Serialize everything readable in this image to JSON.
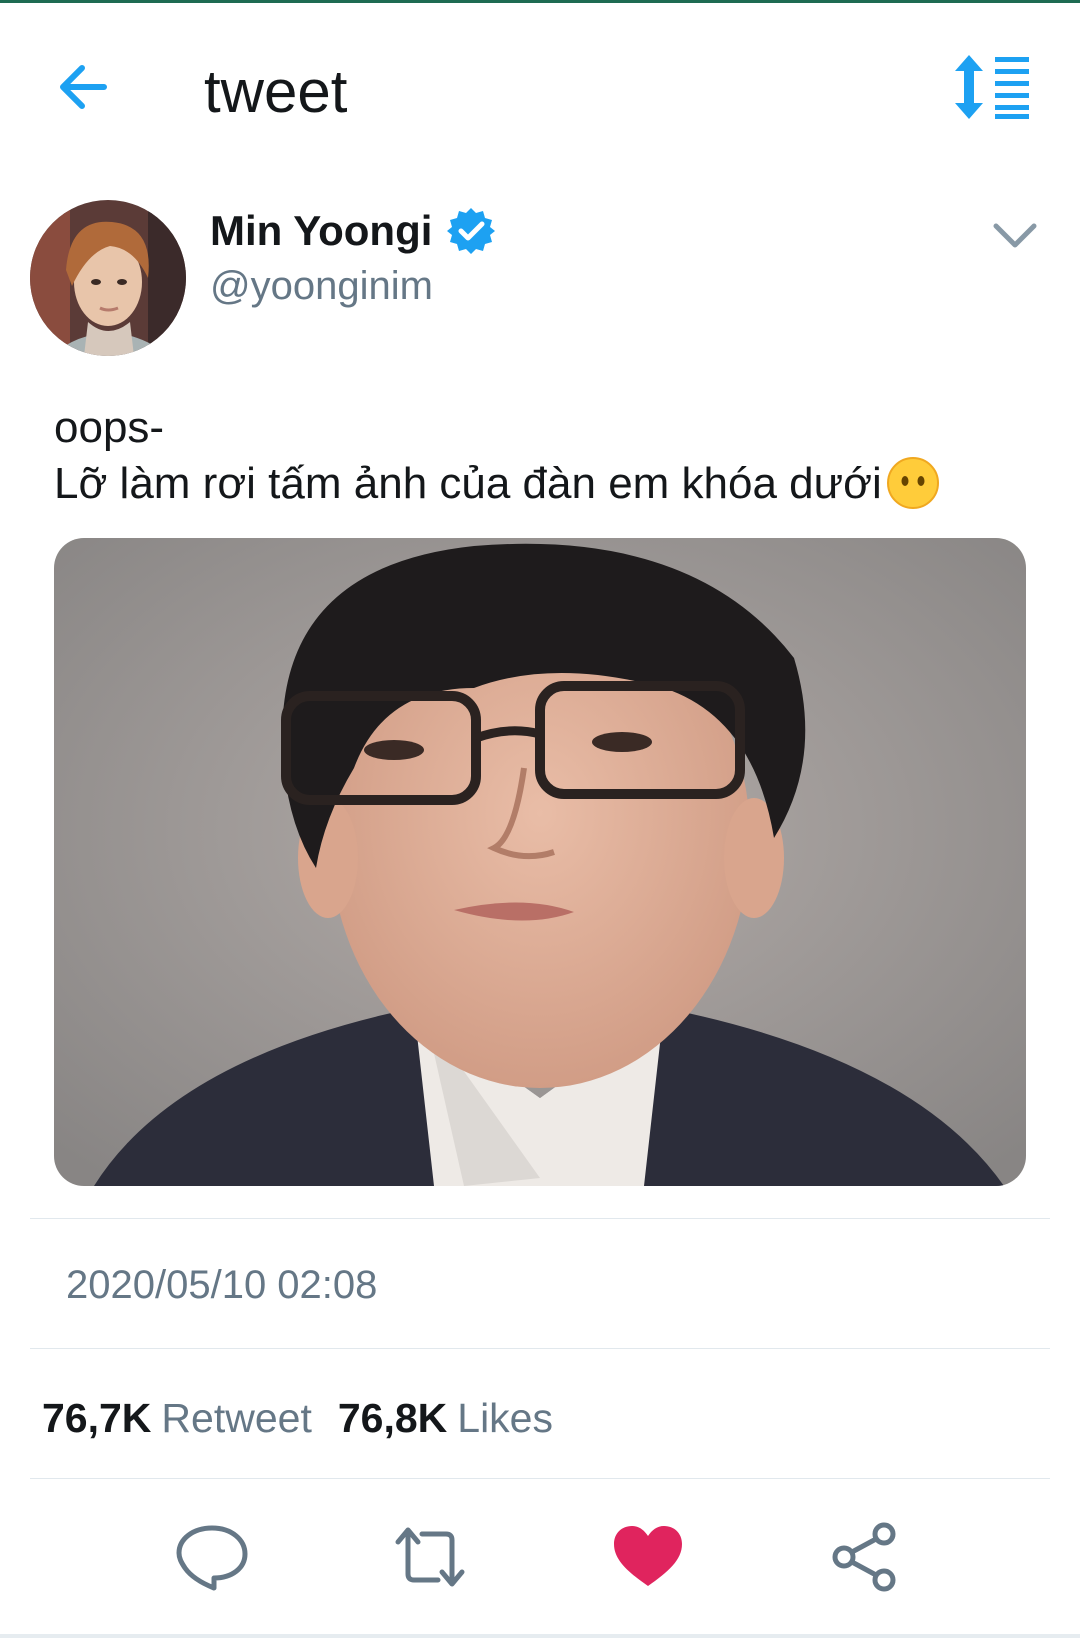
{
  "header": {
    "title": "tweet",
    "back_icon": "arrow-left-icon",
    "sort_icon": "sort-list-icon",
    "accent_color": "#1da1f2"
  },
  "tweet": {
    "author_name": "Min Yoongi",
    "author_handle": "@yoonginim",
    "verified": true,
    "text_lines": [
      "oops-",
      "Lỡ làm rơi tấm ảnh của đàn em khóa dưới"
    ],
    "emoji": "neutral-face-no-mouth",
    "timestamp": "2020/05/10 02:08",
    "retweet_count": "76,7K",
    "retweet_label": "Retweet",
    "like_count": "76,8K",
    "like_label": "Likes"
  },
  "actions": [
    {
      "name": "reply",
      "icon": "reply-icon"
    },
    {
      "name": "retweet",
      "icon": "retweet-icon"
    },
    {
      "name": "like",
      "icon": "heart-icon",
      "active": true,
      "color": "#e0245e"
    },
    {
      "name": "share",
      "icon": "share-icon"
    }
  ]
}
